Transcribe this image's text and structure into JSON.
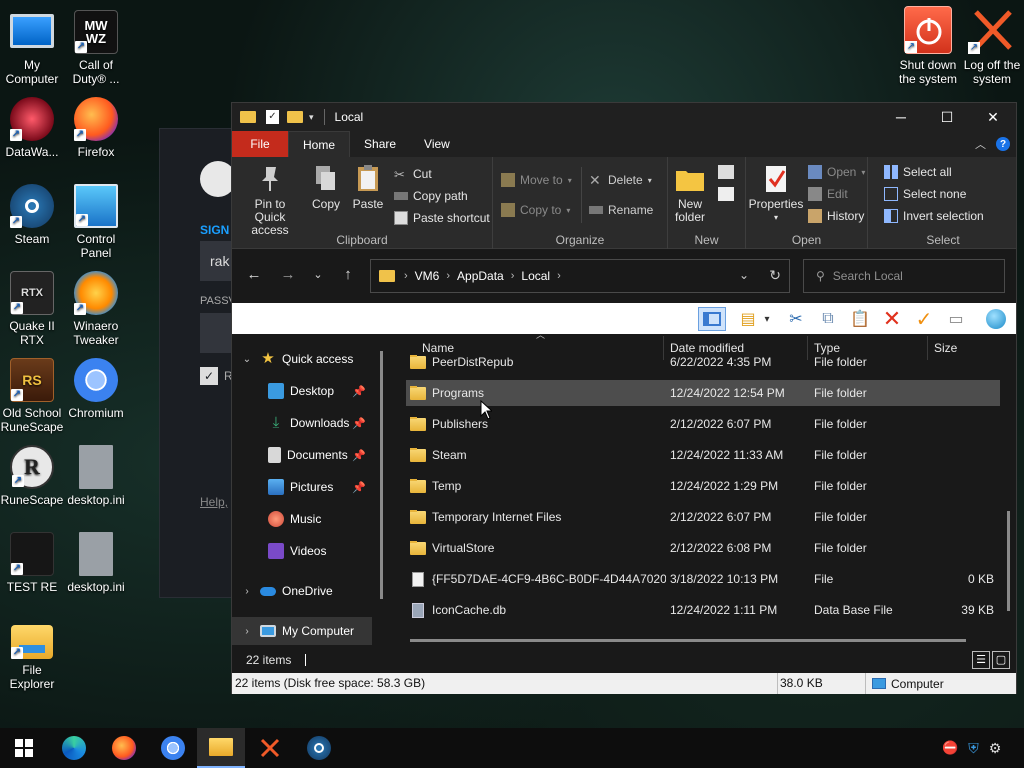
{
  "desktop": {
    "icons": [
      {
        "label": "My Computer"
      },
      {
        "label": "Call of Duty® ..."
      },
      {
        "label": "DataWa..."
      },
      {
        "label": "Firefox"
      },
      {
        "label": "Steam"
      },
      {
        "label": "Control Panel"
      },
      {
        "label": "Quake II RTX"
      },
      {
        "label": "Winaero Tweaker"
      },
      {
        "label": "Old School RuneScape"
      },
      {
        "label": "Chromium"
      },
      {
        "label": "RuneScape"
      },
      {
        "label": "desktop.ini"
      },
      {
        "label": "TEST RE"
      },
      {
        "label": "desktop.ini"
      },
      {
        "label": "File Explorer"
      }
    ],
    "shutdown_label": "Shut down the system",
    "logoff_label": "Log off the system"
  },
  "bg_steam": {
    "sign_in": "SIGN",
    "field_value": "rak",
    "password_label": "PASSV",
    "remember_label": "R",
    "help_link": "Help,"
  },
  "window": {
    "title": "Local",
    "minimize": "─",
    "maximize": "☐",
    "close": "✕"
  },
  "tabs": {
    "file": "File",
    "home": "Home",
    "share": "Share",
    "view": "View"
  },
  "ribbon": {
    "clipboard": {
      "label": "Clipboard",
      "pin": "Pin to Quick access",
      "copy": "Copy",
      "paste": "Paste",
      "cut": "Cut",
      "copy_path": "Copy path",
      "paste_shortcut": "Paste shortcut"
    },
    "organize": {
      "label": "Organize",
      "move_to": "Move to",
      "copy_to": "Copy to",
      "delete": "Delete",
      "rename": "Rename"
    },
    "new": {
      "label": "New",
      "new_folder": "New folder"
    },
    "open": {
      "label": "Open",
      "properties": "Properties",
      "open": "Open",
      "edit": "Edit",
      "history": "History"
    },
    "select": {
      "label": "Select",
      "select_all": "Select all",
      "select_none": "Select none",
      "invert": "Invert selection"
    }
  },
  "address": {
    "crumbs": [
      "VM6",
      "AppData",
      "Local"
    ]
  },
  "search": {
    "placeholder": "Search Local"
  },
  "nav": {
    "quick_access": "Quick access",
    "desktop": "Desktop",
    "downloads": "Downloads",
    "documents": "Documents",
    "pictures": "Pictures",
    "music": "Music",
    "videos": "Videos",
    "onedrive": "OneDrive",
    "my_computer": "My Computer"
  },
  "columns": {
    "name": "Name",
    "date": "Date modified",
    "type": "Type",
    "size": "Size"
  },
  "files": [
    {
      "name": "PeerDistRepub",
      "date": "6/22/2022 4:35 PM",
      "type": "File folder",
      "size": "",
      "icon": "folder"
    },
    {
      "name": "Programs",
      "date": "12/24/2022 12:54 PM",
      "type": "File folder",
      "size": "",
      "icon": "folder"
    },
    {
      "name": "Publishers",
      "date": "2/12/2022 6:07 PM",
      "type": "File folder",
      "size": "",
      "icon": "folder"
    },
    {
      "name": "Steam",
      "date": "12/24/2022 11:33 AM",
      "type": "File folder",
      "size": "",
      "icon": "folder"
    },
    {
      "name": "Temp",
      "date": "12/24/2022 1:29 PM",
      "type": "File folder",
      "size": "",
      "icon": "folder"
    },
    {
      "name": "Temporary Internet Files",
      "date": "2/12/2022 6:07 PM",
      "type": "File folder",
      "size": "",
      "icon": "folder-shortcut"
    },
    {
      "name": "VirtualStore",
      "date": "2/12/2022 6:08 PM",
      "type": "File folder",
      "size": "",
      "icon": "folder"
    },
    {
      "name": "{FF5D7DAE-4CF9-4B6C-B0DF-4D44A7020...",
      "date": "3/18/2022 10:13 PM",
      "type": "File",
      "size": "0 KB",
      "icon": "file"
    },
    {
      "name": "IconCache.db",
      "date": "12/24/2022 1:11 PM",
      "type": "Data Base File",
      "size": "39 KB",
      "icon": "db"
    }
  ],
  "count_bar": {
    "items": "22 items"
  },
  "status": {
    "summary": "22 items (Disk free space: 58.3 GB)",
    "size": "38.0 KB",
    "location": "Computer"
  }
}
